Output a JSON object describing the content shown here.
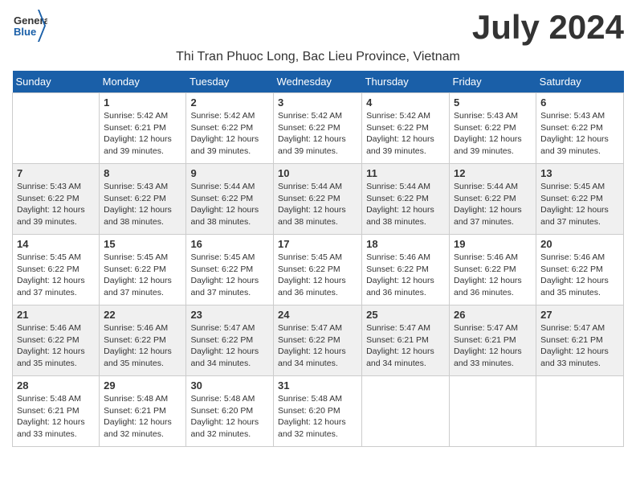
{
  "header": {
    "logo_general": "General",
    "logo_blue": "Blue",
    "month_title": "July 2024",
    "location": "Thi Tran Phuoc Long, Bac Lieu Province, Vietnam"
  },
  "days_of_week": [
    "Sunday",
    "Monday",
    "Tuesday",
    "Wednesday",
    "Thursday",
    "Friday",
    "Saturday"
  ],
  "weeks": [
    [
      {
        "day": "",
        "info": ""
      },
      {
        "day": "1",
        "info": "Sunrise: 5:42 AM\nSunset: 6:21 PM\nDaylight: 12 hours\nand 39 minutes."
      },
      {
        "day": "2",
        "info": "Sunrise: 5:42 AM\nSunset: 6:22 PM\nDaylight: 12 hours\nand 39 minutes."
      },
      {
        "day": "3",
        "info": "Sunrise: 5:42 AM\nSunset: 6:22 PM\nDaylight: 12 hours\nand 39 minutes."
      },
      {
        "day": "4",
        "info": "Sunrise: 5:42 AM\nSunset: 6:22 PM\nDaylight: 12 hours\nand 39 minutes."
      },
      {
        "day": "5",
        "info": "Sunrise: 5:43 AM\nSunset: 6:22 PM\nDaylight: 12 hours\nand 39 minutes."
      },
      {
        "day": "6",
        "info": "Sunrise: 5:43 AM\nSunset: 6:22 PM\nDaylight: 12 hours\nand 39 minutes."
      }
    ],
    [
      {
        "day": "7",
        "info": "Sunrise: 5:43 AM\nSunset: 6:22 PM\nDaylight: 12 hours\nand 39 minutes."
      },
      {
        "day": "8",
        "info": "Sunrise: 5:43 AM\nSunset: 6:22 PM\nDaylight: 12 hours\nand 38 minutes."
      },
      {
        "day": "9",
        "info": "Sunrise: 5:44 AM\nSunset: 6:22 PM\nDaylight: 12 hours\nand 38 minutes."
      },
      {
        "day": "10",
        "info": "Sunrise: 5:44 AM\nSunset: 6:22 PM\nDaylight: 12 hours\nand 38 minutes."
      },
      {
        "day": "11",
        "info": "Sunrise: 5:44 AM\nSunset: 6:22 PM\nDaylight: 12 hours\nand 38 minutes."
      },
      {
        "day": "12",
        "info": "Sunrise: 5:44 AM\nSunset: 6:22 PM\nDaylight: 12 hours\nand 37 minutes."
      },
      {
        "day": "13",
        "info": "Sunrise: 5:45 AM\nSunset: 6:22 PM\nDaylight: 12 hours\nand 37 minutes."
      }
    ],
    [
      {
        "day": "14",
        "info": "Sunrise: 5:45 AM\nSunset: 6:22 PM\nDaylight: 12 hours\nand 37 minutes."
      },
      {
        "day": "15",
        "info": "Sunrise: 5:45 AM\nSunset: 6:22 PM\nDaylight: 12 hours\nand 37 minutes."
      },
      {
        "day": "16",
        "info": "Sunrise: 5:45 AM\nSunset: 6:22 PM\nDaylight: 12 hours\nand 37 minutes."
      },
      {
        "day": "17",
        "info": "Sunrise: 5:45 AM\nSunset: 6:22 PM\nDaylight: 12 hours\nand 36 minutes."
      },
      {
        "day": "18",
        "info": "Sunrise: 5:46 AM\nSunset: 6:22 PM\nDaylight: 12 hours\nand 36 minutes."
      },
      {
        "day": "19",
        "info": "Sunrise: 5:46 AM\nSunset: 6:22 PM\nDaylight: 12 hours\nand 36 minutes."
      },
      {
        "day": "20",
        "info": "Sunrise: 5:46 AM\nSunset: 6:22 PM\nDaylight: 12 hours\nand 35 minutes."
      }
    ],
    [
      {
        "day": "21",
        "info": "Sunrise: 5:46 AM\nSunset: 6:22 PM\nDaylight: 12 hours\nand 35 minutes."
      },
      {
        "day": "22",
        "info": "Sunrise: 5:46 AM\nSunset: 6:22 PM\nDaylight: 12 hours\nand 35 minutes."
      },
      {
        "day": "23",
        "info": "Sunrise: 5:47 AM\nSunset: 6:22 PM\nDaylight: 12 hours\nand 34 minutes."
      },
      {
        "day": "24",
        "info": "Sunrise: 5:47 AM\nSunset: 6:22 PM\nDaylight: 12 hours\nand 34 minutes."
      },
      {
        "day": "25",
        "info": "Sunrise: 5:47 AM\nSunset: 6:21 PM\nDaylight: 12 hours\nand 34 minutes."
      },
      {
        "day": "26",
        "info": "Sunrise: 5:47 AM\nSunset: 6:21 PM\nDaylight: 12 hours\nand 33 minutes."
      },
      {
        "day": "27",
        "info": "Sunrise: 5:47 AM\nSunset: 6:21 PM\nDaylight: 12 hours\nand 33 minutes."
      }
    ],
    [
      {
        "day": "28",
        "info": "Sunrise: 5:48 AM\nSunset: 6:21 PM\nDaylight: 12 hours\nand 33 minutes."
      },
      {
        "day": "29",
        "info": "Sunrise: 5:48 AM\nSunset: 6:21 PM\nDaylight: 12 hours\nand 32 minutes."
      },
      {
        "day": "30",
        "info": "Sunrise: 5:48 AM\nSunset: 6:20 PM\nDaylight: 12 hours\nand 32 minutes."
      },
      {
        "day": "31",
        "info": "Sunrise: 5:48 AM\nSunset: 6:20 PM\nDaylight: 12 hours\nand 32 minutes."
      },
      {
        "day": "",
        "info": ""
      },
      {
        "day": "",
        "info": ""
      },
      {
        "day": "",
        "info": ""
      }
    ]
  ]
}
